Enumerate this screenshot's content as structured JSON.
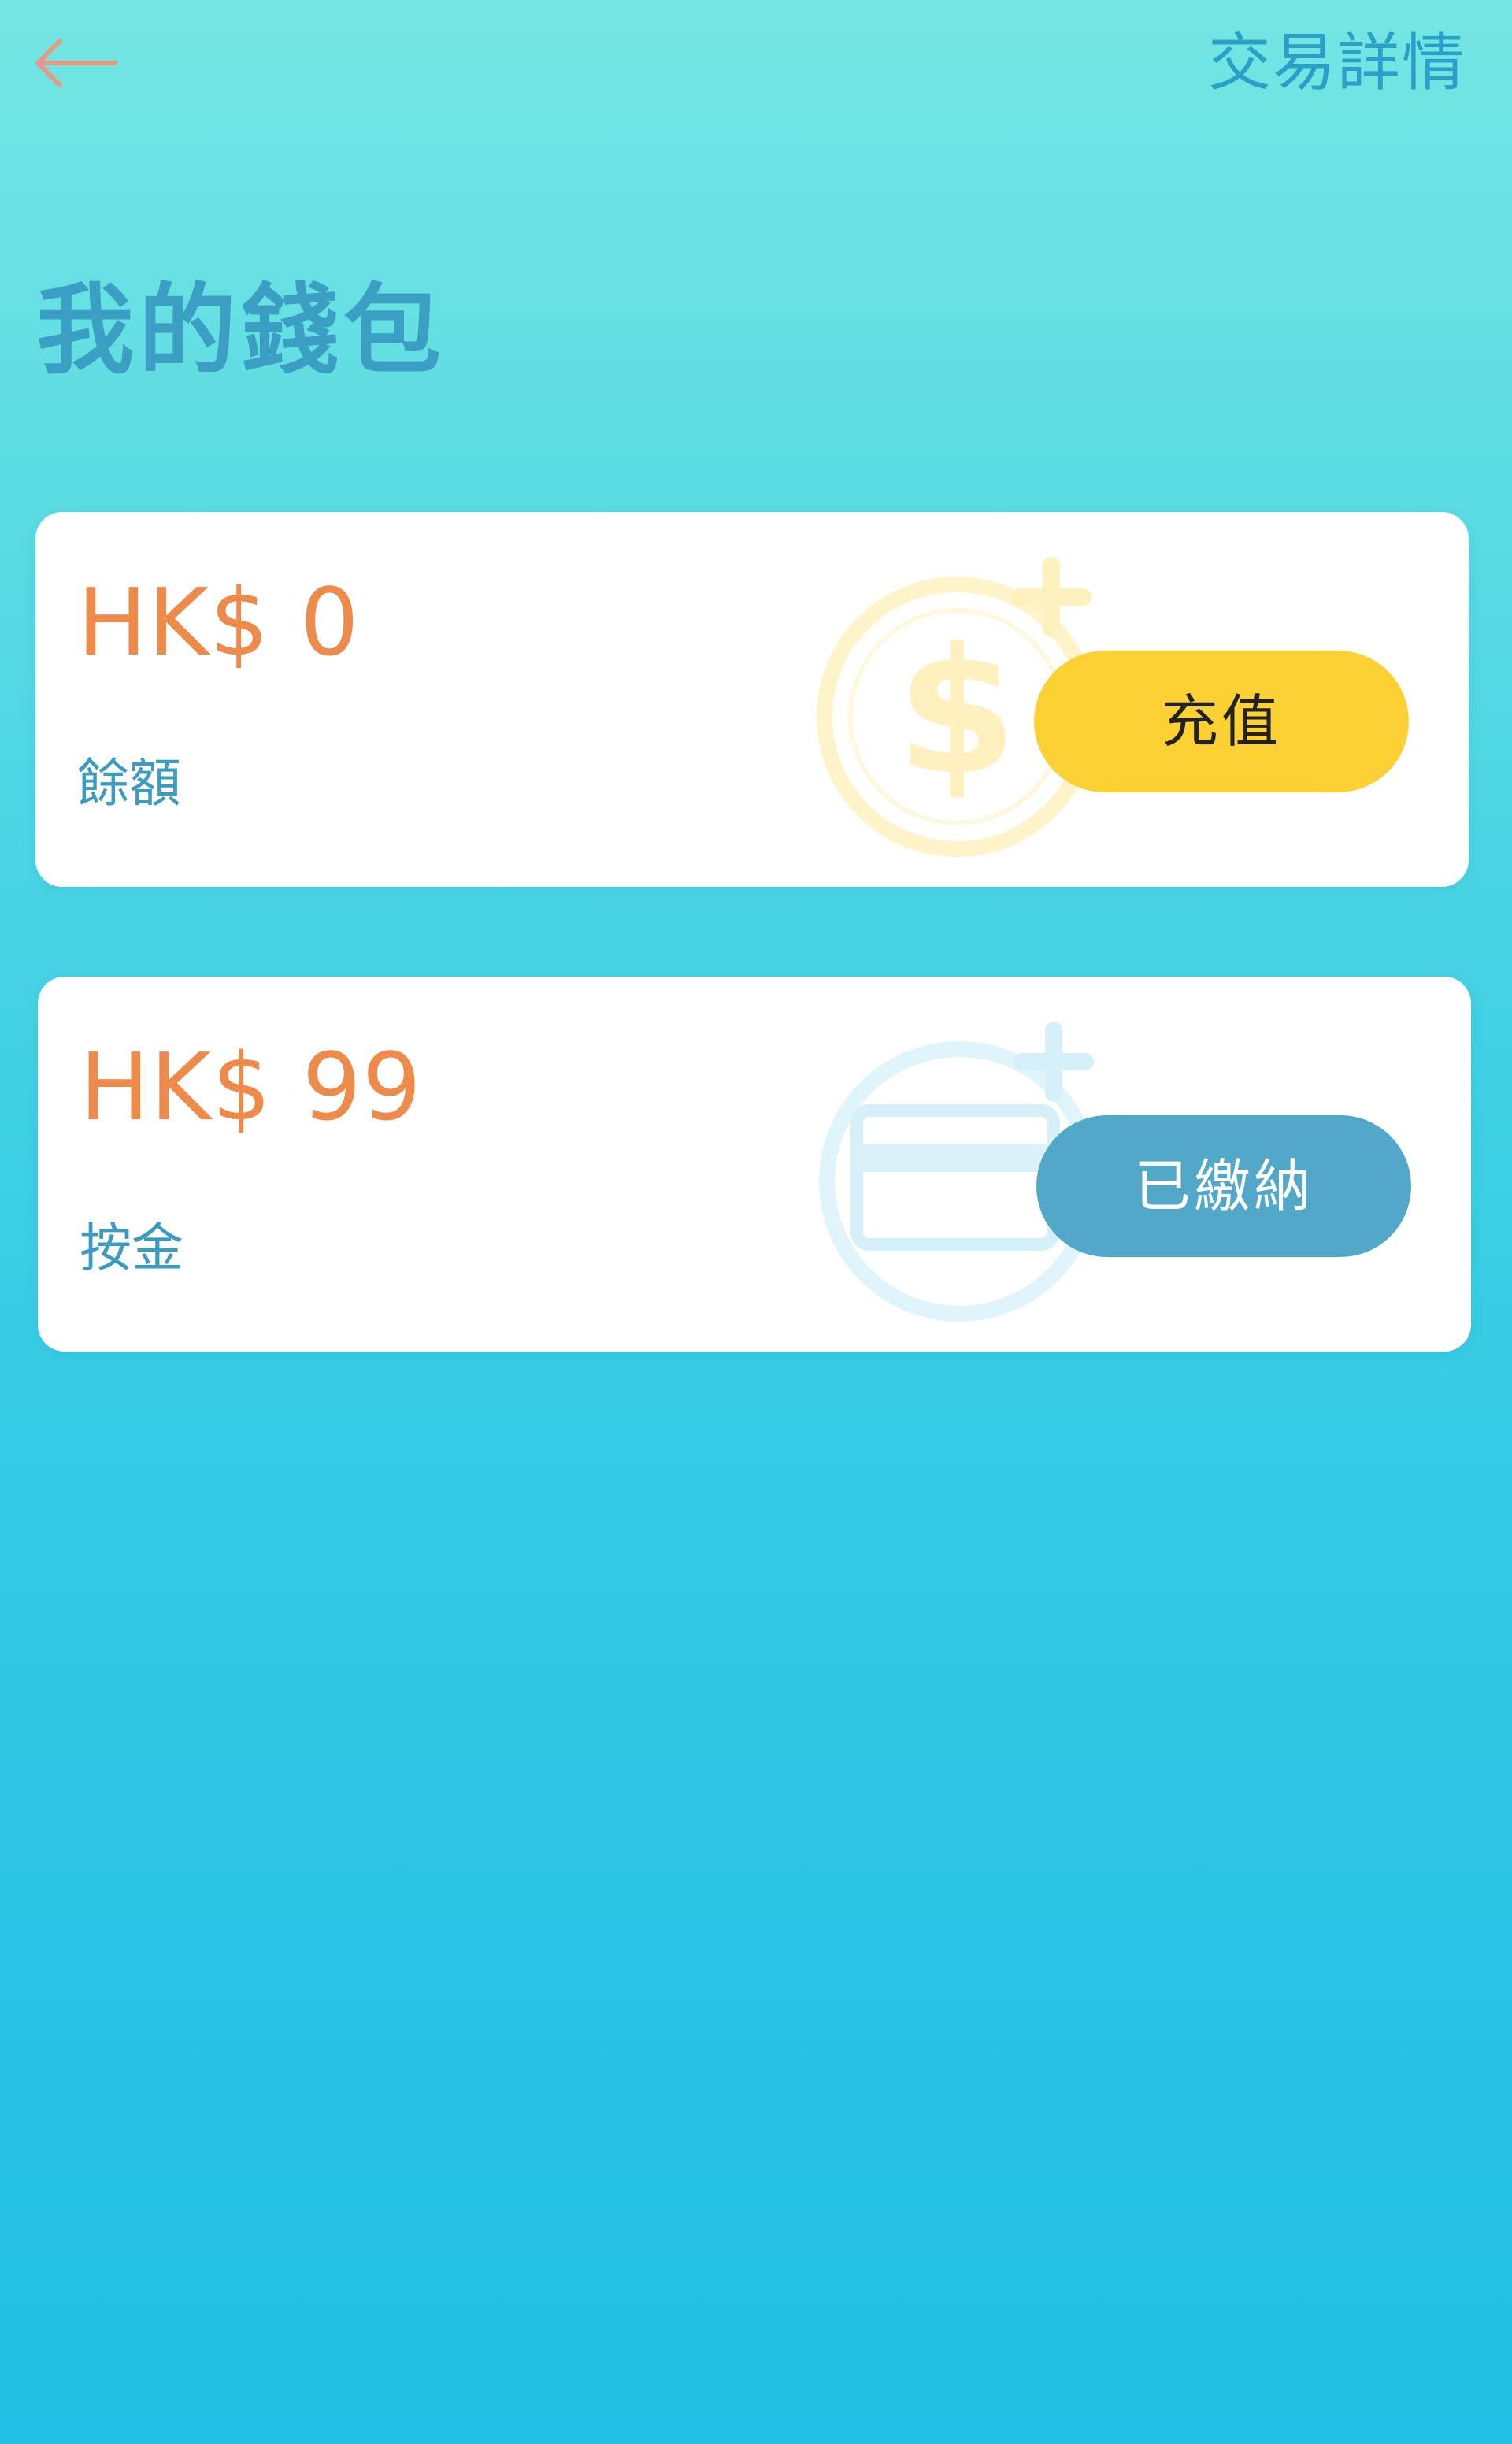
{
  "header": {
    "back_icon": "arrow-left-icon",
    "transaction_details_label": "交易詳情"
  },
  "page": {
    "title": "我的錢包"
  },
  "balance_card": {
    "amount": "HK$ 0",
    "caption": "餘額",
    "button_label": "充值",
    "watermark_icon": "dollar-coin-plus-icon",
    "button_color": "#fdd134",
    "amount_color": "#ee8a4a"
  },
  "deposit_card": {
    "amount": "HK$ 99",
    "caption": "按金",
    "button_label": "已繳納",
    "watermark_icon": "credit-card-plus-icon",
    "button_color": "#52a8c8",
    "amount_color": "#ee8a4a"
  },
  "colors": {
    "background_top": "#74e6e3",
    "background_bottom": "#22bfe4",
    "accent_text": "#3a9cc1"
  }
}
